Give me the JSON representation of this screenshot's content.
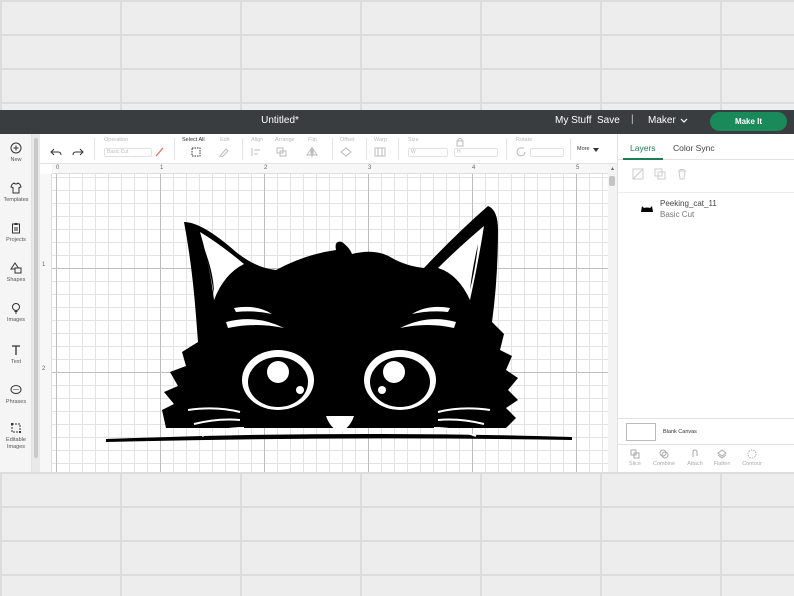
{
  "header": {
    "title": "Untitled*",
    "my_stuff": "My Stuff",
    "save": "Save",
    "separator": "|",
    "machine": "Maker",
    "make_it": "Make It"
  },
  "leftnav": [
    {
      "label": "New",
      "icon": "plus-circle-icon"
    },
    {
      "label": "Templates",
      "icon": "shirt-icon"
    },
    {
      "label": "Projects",
      "icon": "clipboard-icon"
    },
    {
      "label": "Shapes",
      "icon": "shapes-icon"
    },
    {
      "label": "Images",
      "icon": "bulb-icon"
    },
    {
      "label": "Text",
      "icon": "text-icon"
    },
    {
      "label": "Phrases",
      "icon": "speech-icon"
    },
    {
      "label": "Editable Images",
      "icon": "editable-image-icon"
    }
  ],
  "toolbar": {
    "operation_label": "Operation",
    "operation_value": "Basic Cut",
    "select_all": "Select All",
    "edit": "Edit",
    "align": "Align",
    "arrange": "Arrange",
    "flip": "Flip",
    "offset": "Offset",
    "warp": "Warp",
    "size": "Size",
    "size_w": "W",
    "size_h": "H",
    "rotate": "Rotate",
    "more": "More"
  },
  "ruler": {
    "top": [
      "0",
      "1",
      "2",
      "3",
      "4",
      "5"
    ],
    "left": [
      "1",
      "2"
    ]
  },
  "panel": {
    "tabs": [
      "Layers",
      "Color Sync"
    ],
    "layer": {
      "name": "Peeking_cat_11",
      "operation": "Basic Cut"
    },
    "blank_canvas": "Blank Canvas",
    "actions": [
      "Slice",
      "Combine",
      "Attach",
      "Flatten",
      "Contour"
    ]
  },
  "colors": {
    "topbar": "#3a3d40",
    "make_it": "#1b8a5a",
    "tab_active": "#1b7e52"
  }
}
